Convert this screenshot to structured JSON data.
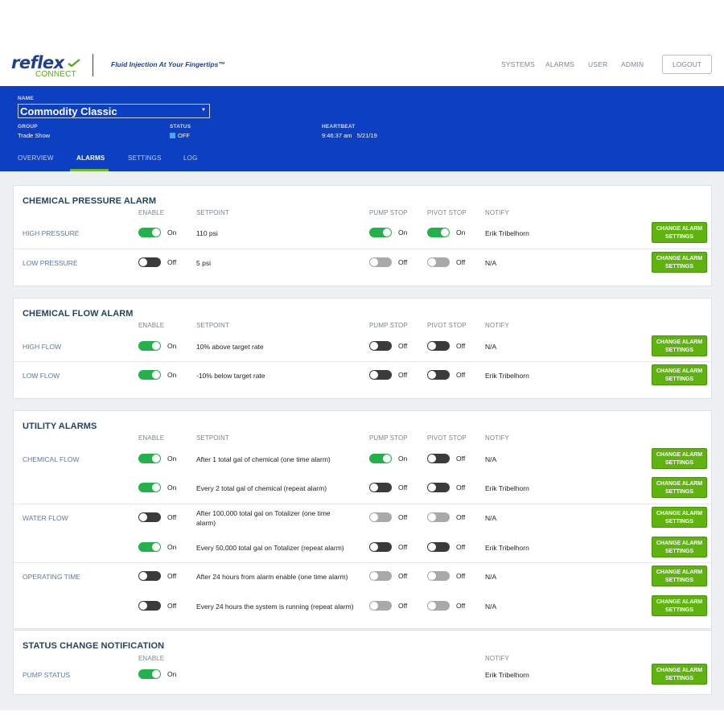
{
  "brand": {
    "name": "reflex",
    "sub": "CONNECT",
    "tagline": "Fluid Injection At Your Fingertips™"
  },
  "nav": [
    "SYSTEMS",
    "ALARMS",
    "USER",
    "ADMIN"
  ],
  "logout_label": "LOGOUT",
  "system": {
    "name_label": "NAME",
    "name": "Commodity Classic",
    "group_label": "GROUP",
    "group": "Trade Show",
    "status_label": "STATUS",
    "status": "OFF",
    "heartbeat_label": "HEARTBEAT",
    "heartbeat": "9:46:37 am   5/21/19"
  },
  "tabs": [
    "OVERVIEW",
    "ALARMS",
    "SETTINGS",
    "LOG"
  ],
  "columns": {
    "enable": "ENABLE",
    "setpoint": "SETPOINT",
    "pump_stop": "PUMP STOP",
    "pivot_stop": "PIVOT STOP",
    "notify": "NOTIFY"
  },
  "change_button": "CHANGE ALARM SETTINGS",
  "panels": [
    {
      "title": "CHEMICAL PRESSURE ALARM",
      "rows": [
        {
          "label": "HIGH PRESSURE",
          "enable": "On",
          "setpoint": "110 psi",
          "pump": "On",
          "pivot": "On",
          "notify": "Erik Tribelhorn"
        },
        {
          "label": "LOW PRESSURE",
          "enable": "Off",
          "setpoint": "5 psi",
          "pump": "Off",
          "pivot": "Off",
          "notify": "N/A"
        }
      ]
    },
    {
      "title": "CHEMICAL FLOW ALARM",
      "rows": [
        {
          "label": "HIGH FLOW",
          "enable": "On",
          "setpoint": "10% above target rate",
          "pump": "Off",
          "pivot": "Off",
          "notify": "N/A"
        },
        {
          "label": "LOW FLOW",
          "enable": "On",
          "setpoint": "-10% below target rate",
          "pump": "Off",
          "pivot": "Off",
          "notify": "Erik Tribelhorn"
        }
      ]
    },
    {
      "title": "UTILITY ALARMS",
      "rows": [
        {
          "label": "CHEMICAL FLOW",
          "enable": "On",
          "setpoint": "After 1 total gal of chemical (one time alarm)",
          "pump": "On",
          "pivot": "Off",
          "notify": "N/A"
        },
        {
          "label": "",
          "enable": "On",
          "setpoint": "Every 2 total gal of chemical (repeat alarm)",
          "pump": "Off",
          "pivot": "Off",
          "notify": "Erik Tribelhorn"
        },
        {
          "label": "WATER FLOW",
          "enable": "Off",
          "setpoint": "After 100,000 total gal on Totalizer (one time alarm)",
          "pump": "Off",
          "pivot": "Off",
          "notify": "N/A"
        },
        {
          "label": "",
          "enable": "On",
          "setpoint": "Every 50,000 total gal on Totalizer (repeat alarm)",
          "pump": "Off",
          "pivot": "Off",
          "notify": "Erik Tribelhorn"
        },
        {
          "label": "OPERATING TIME",
          "enable": "Off",
          "setpoint": "After 24 hours from alarm enable (one time alarm)",
          "pump": "Off",
          "pivot": "Off",
          "notify": "N/A"
        },
        {
          "label": "",
          "enable": "Off",
          "setpoint": "Every 24 hours the system is running (repeat alarm)",
          "pump": "Off",
          "pivot": "Off",
          "notify": "N/A"
        }
      ]
    },
    {
      "title": "STATUS CHANGE NOTIFICATION",
      "rows": [
        {
          "label": "PUMP STATUS",
          "enable": "On",
          "notify": "Erik Tribelhorn"
        }
      ]
    }
  ]
}
